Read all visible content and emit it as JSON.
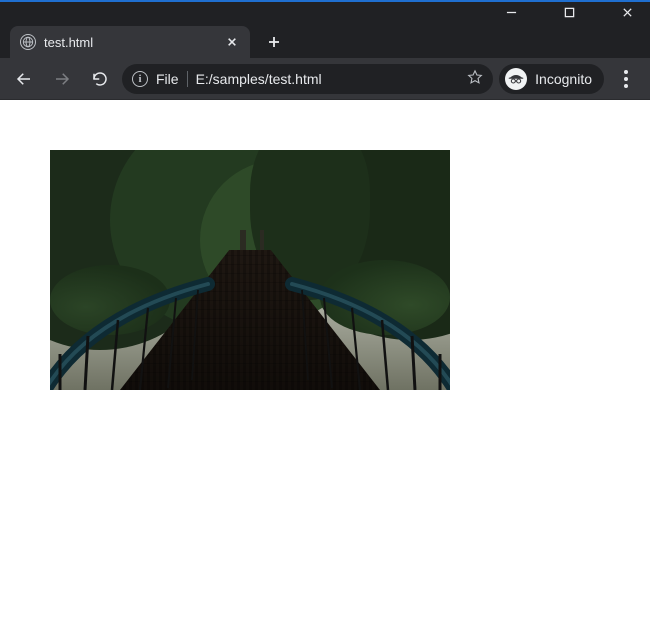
{
  "window": {
    "minimize_tip": "Minimize",
    "maximize_tip": "Maximize",
    "close_tip": "Close"
  },
  "tab": {
    "title": "test.html",
    "close_tip": "Close tab",
    "new_tab_tip": "New tab"
  },
  "toolbar": {
    "back_tip": "Back",
    "forward_tip": "Forward",
    "reload_tip": "Reload",
    "menu_tip": "Customize and control"
  },
  "omnibox": {
    "info_tip": "View site information",
    "scheme": "File",
    "path": "E:/samples/test.html",
    "bookmark_tip": "Bookmark this tab"
  },
  "incognito": {
    "label": "Incognito"
  },
  "page": {
    "image_alt": "Footbridge through forest"
  }
}
